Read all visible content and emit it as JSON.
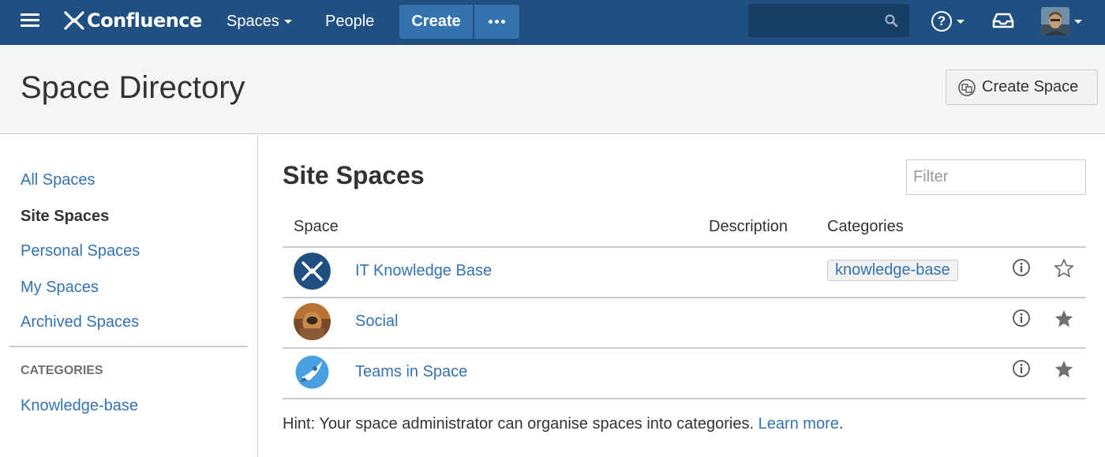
{
  "topnav": {
    "logo_text": "Confluence",
    "spaces_label": "Spaces",
    "people_label": "People",
    "create_label": "Create",
    "more_icon": "ellipsis-icon",
    "help_icon": "question-circle-icon",
    "notifications_icon": "inbox-tray-icon"
  },
  "header": {
    "title": "Space Directory",
    "create_space_label": "Create Space"
  },
  "sidebar": {
    "links": [
      "All Spaces",
      "Site Spaces",
      "Personal Spaces",
      "My Spaces",
      "Archived Spaces"
    ],
    "active": "Site Spaces",
    "categories_heading": "CATEGORIES",
    "categories": [
      "Knowledge-base"
    ]
  },
  "main": {
    "title": "Site Spaces",
    "filter_placeholder": "Filter",
    "columns": {
      "space": "Space",
      "description": "Description",
      "categories": "Categories"
    },
    "rows": [
      {
        "name": "IT Knowledge Base",
        "description": "",
        "category": "knowledge-base",
        "favourite": false
      },
      {
        "name": "Social",
        "description": "",
        "category": "",
        "favourite": true
      },
      {
        "name": "Teams in Space",
        "description": "",
        "category": "",
        "favourite": true
      }
    ],
    "hint_text": "Hint: Your space administrator can organise spaces into categories.",
    "hint_link": "Learn more",
    "hint_end": "."
  },
  "colors": {
    "nav_bg": "#205081",
    "accent": "#3572b0",
    "header_bg": "#f5f5f5"
  }
}
